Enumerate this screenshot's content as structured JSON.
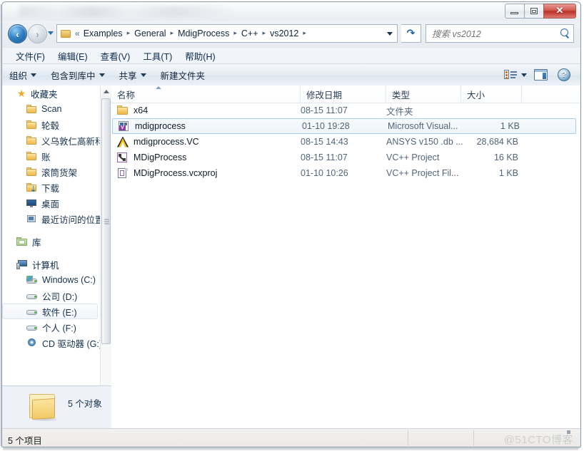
{
  "window": {
    "title_blurred": true,
    "controls": {
      "minimize": "minimize",
      "maximize": "restore",
      "close": "✕"
    }
  },
  "address_bar": {
    "back_label": "←",
    "forward_label": "→",
    "breadcrumb_chevrons": "«",
    "breadcrumb": [
      "Examples",
      "General",
      "MdigProcess",
      "C++",
      "vs2012"
    ],
    "separator": "▸",
    "refresh_label": "↻",
    "search": {
      "placeholder": "搜索 vs2012",
      "value": ""
    }
  },
  "menu_bar": {
    "items": [
      {
        "label": "文件(F)"
      },
      {
        "label": "编辑(E)"
      },
      {
        "label": "查看(V)"
      },
      {
        "label": "工具(T)"
      },
      {
        "label": "帮助(H)"
      }
    ]
  },
  "command_bar": {
    "items": [
      {
        "label": "组织",
        "has_caret": true
      },
      {
        "label": "包含到库中",
        "has_caret": true
      },
      {
        "label": "共享",
        "has_caret": true
      },
      {
        "label": "新建文件夹",
        "has_caret": false
      }
    ],
    "right_icons": [
      "view-mode-icon",
      "chevron-down-icon",
      "preview-pane-icon",
      "help-icon"
    ],
    "help_glyph": "?"
  },
  "nav_pane": {
    "groups": [
      {
        "name": "收藏夹",
        "icon": "star-icon",
        "children": [
          {
            "label": "Scan",
            "icon": "folder-icon"
          },
          {
            "label": "轮毂",
            "icon": "folder-icon"
          },
          {
            "label": "义乌敦仁高新科技",
            "icon": "folder-icon"
          },
          {
            "label": "账",
            "icon": "folder-icon"
          },
          {
            "label": "滚筒货架",
            "icon": "folder-icon"
          },
          {
            "label": "下载",
            "icon": "download-folder-icon"
          },
          {
            "label": "桌面",
            "icon": "desktop-icon"
          },
          {
            "label": "最近访问的位置",
            "icon": "recent-places-icon"
          }
        ]
      },
      {
        "name": "库",
        "icon": "library-icon",
        "children": []
      },
      {
        "name": "计算机",
        "icon": "computer-icon",
        "children": [
          {
            "label": "Windows (C:)",
            "icon": "windows-drive-icon",
            "hovered": false
          },
          {
            "label": "公司 (D:)",
            "icon": "drive-icon",
            "hovered": false
          },
          {
            "label": "软件 (E:)",
            "icon": "drive-icon",
            "hovered": true
          },
          {
            "label": "个人 (F:)",
            "icon": "drive-icon",
            "hovered": false
          },
          {
            "label": "CD 驱动器 (G:) F",
            "icon": "cd-drive-icon",
            "hovered": false
          }
        ]
      }
    ]
  },
  "details_pane": {
    "icon": "large-folder-icon",
    "text": "5 个对象"
  },
  "file_list": {
    "columns": [
      {
        "label": "名称",
        "sorted": "asc"
      },
      {
        "label": "修改日期"
      },
      {
        "label": "类型"
      },
      {
        "label": "大小"
      }
    ],
    "rows": [
      {
        "name": "x64",
        "icon": "folder-icon",
        "date": "08-15 11:07",
        "type": "文件夹",
        "size": "",
        "selected": false
      },
      {
        "name": "mdigprocess",
        "icon": "visual-studio-solution-icon",
        "date": "01-10 19:28",
        "type": "Microsoft Visual...",
        "size": "1 KB",
        "selected": true
      },
      {
        "name": "mdigprocess.VC",
        "icon": "ansys-file-icon",
        "date": "08-15 14:43",
        "type": "ANSYS v150 .db ...",
        "size": "28,684 KB",
        "selected": false
      },
      {
        "name": "MDigProcess",
        "icon": "vcxx-project-icon",
        "date": "08-15 11:07",
        "type": "VC++ Project",
        "size": "16 KB",
        "selected": false
      },
      {
        "name": "MDigProcess.vcxproj",
        "icon": "vcxproj-file-icon",
        "date": "01-10 10:26",
        "type": "VC++ Project Fil...",
        "size": "1 KB",
        "selected": false
      }
    ]
  },
  "status_bar": {
    "item_count": "5 个项目",
    "watermark": "@51CTO博客"
  },
  "colors": {
    "accent_blue": "#2f7fc4",
    "close_red": "#bb2f27",
    "folder_yellow": "#f6cd72",
    "selection_border": "#a8cdeb"
  }
}
